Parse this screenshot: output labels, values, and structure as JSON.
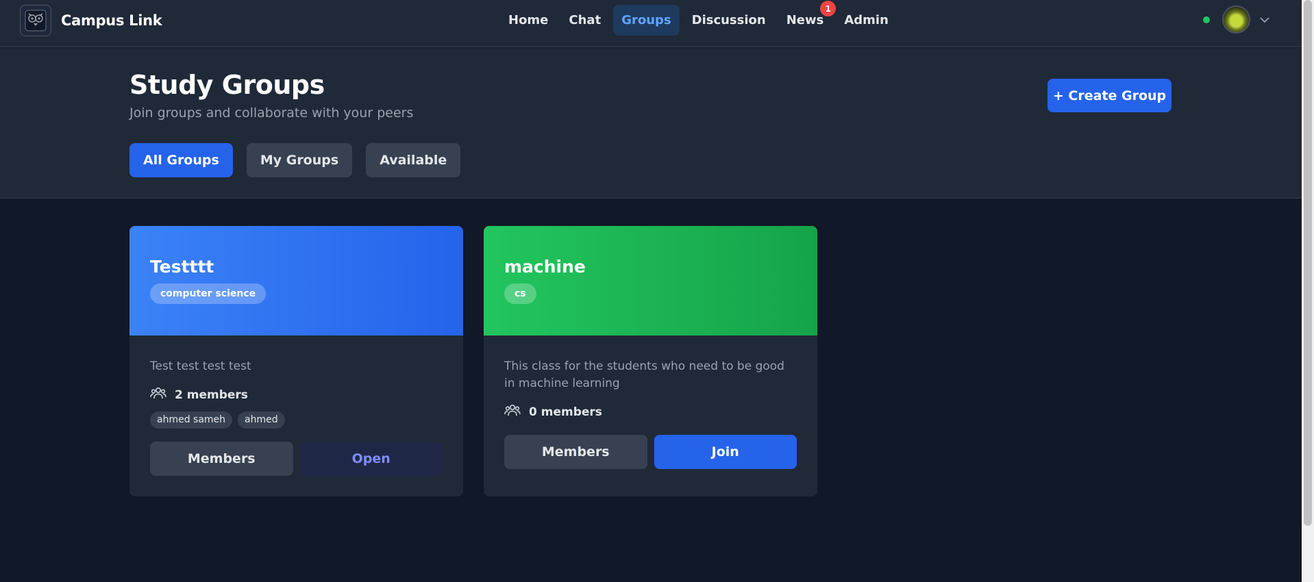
{
  "app": {
    "name": "Campus Link",
    "logo_icon": "owl-logo-icon"
  },
  "nav": {
    "items": [
      {
        "label": "Home",
        "active": false
      },
      {
        "label": "Chat",
        "active": false
      },
      {
        "label": "Groups",
        "active": true
      },
      {
        "label": "Discussion",
        "active": false
      },
      {
        "label": "News",
        "active": false,
        "badge": "1"
      },
      {
        "label": "Admin",
        "active": false
      }
    ]
  },
  "user": {
    "online_status_color": "#22c55e",
    "menu_icon": "chevron-down-icon"
  },
  "header": {
    "title": "Study Groups",
    "subtitle": "Join groups and collaborate with your peers",
    "create_label": "+ Create Group"
  },
  "filters": {
    "tabs": [
      {
        "label": "All Groups",
        "active": true
      },
      {
        "label": "My Groups",
        "active": false
      },
      {
        "label": "Available",
        "active": false
      }
    ]
  },
  "groups": [
    {
      "name": "Testttt",
      "tag": "computer science",
      "banner_color": "#3b82f6",
      "description": "Test test test test",
      "members_text": "2 members",
      "member_chips": [
        "ahmed sameh",
        "ahmed"
      ],
      "members_button": "Members",
      "action_button": "Open"
    },
    {
      "name": "machine",
      "tag": "cs",
      "banner_color": "#22c55e",
      "description": "This class for the students who need to be good in machine learning",
      "members_text": "0 members",
      "member_chips": [],
      "members_button": "Members",
      "action_button": "Join"
    }
  ],
  "colors": {
    "accent": "#2563eb",
    "background": "#111827",
    "surface": "#1f2937",
    "badge": "#ef4444"
  }
}
